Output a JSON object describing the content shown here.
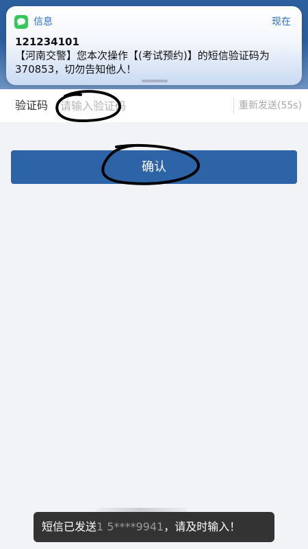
{
  "notification": {
    "app_icon": "messages-bubble-icon",
    "app_name": "信息",
    "time": "现在",
    "sender": "121234101",
    "body": "【河南交警】您本次操作【(考试预约)】的短信验证码为370853，切勿告知他人！"
  },
  "form": {
    "code_label": "验证码",
    "code_placeholder": "请输入验证码",
    "code_value": "",
    "resend_label": "重新发送(55s)"
  },
  "confirm_label": "确认",
  "toast": {
    "prefix": "短信已发送",
    "masked_phone": "1 5****9941",
    "suffix": "，请及时输入！"
  },
  "colors": {
    "primary": "#2d63a7",
    "header": "#2b5f9e",
    "notification_accent": "#2a6fc9"
  }
}
